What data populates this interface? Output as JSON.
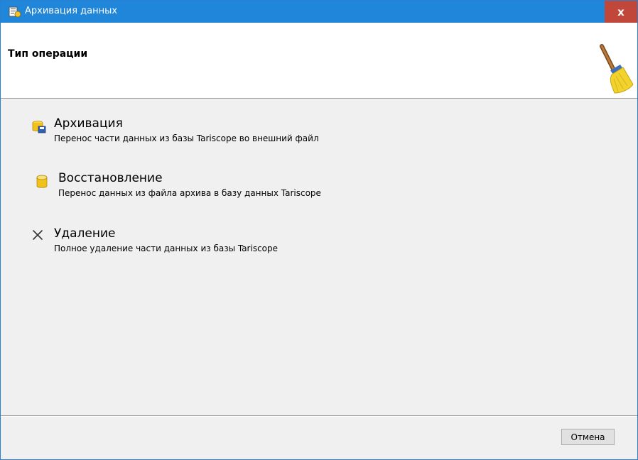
{
  "window": {
    "title": "Архивация данных",
    "close_label": "x"
  },
  "header": {
    "title": "Тип операции",
    "icon": "broom-icon"
  },
  "options": [
    {
      "title": "Архивация",
      "description": "Перенос части данных из базы Tariscope во внешний файл",
      "icon": "archive-icon"
    },
    {
      "title": "Восстановление",
      "description": "Перенос данных из файла архива в базу данных Tariscope",
      "icon": "database-icon"
    },
    {
      "title": "Удаление",
      "description": "Полное удаление части данных из базы Tariscope",
      "icon": "delete-x-icon"
    }
  ],
  "footer": {
    "cancel_label": "Отмена"
  },
  "colors": {
    "titlebar": "#1f86d9",
    "close_button": "#c1473a",
    "body": "#f0f0f0"
  }
}
